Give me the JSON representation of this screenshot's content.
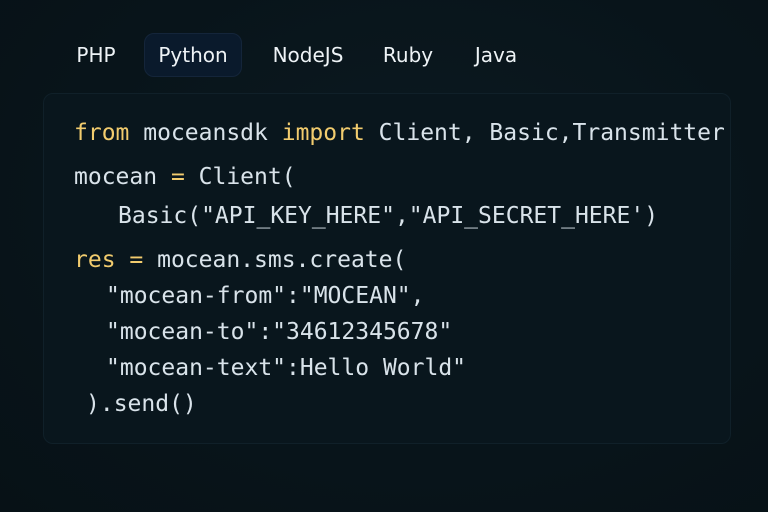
{
  "tabs": [
    {
      "label": "PHP",
      "active": false
    },
    {
      "label": "Python",
      "active": true
    },
    {
      "label": "NodeJS",
      "active": false
    },
    {
      "label": "Ruby",
      "active": false
    },
    {
      "label": "Java",
      "active": false
    }
  ],
  "colors": {
    "keyword": "#f2cc6e",
    "text": "#d9e3ea",
    "active_tab_bg": "#0a1a2c",
    "panel_bg": "#09161d"
  },
  "code": {
    "line1": {
      "kw1": "from",
      "mod": " moceansdk ",
      "kw2": "import",
      "rest": " Client, Basic,Transmitter"
    },
    "line2": {
      "var": "mocean ",
      "op": "=",
      "rest": " Client("
    },
    "line3": {
      "text": "Basic(\"API_KEY_HERE\",\"API_SECRET_HERE')"
    },
    "line4": {
      "var": "res ",
      "op": "=",
      "rest": " mocean.sms.create("
    },
    "line5": {
      "text": "\"mocean-from\":\"MOCEAN\","
    },
    "line6": {
      "text": "\"mocean-to\":\"34612345678\""
    },
    "line7": {
      "text": "\"mocean-text\":Hello World\""
    },
    "line8": {
      "text": ").send()"
    }
  }
}
